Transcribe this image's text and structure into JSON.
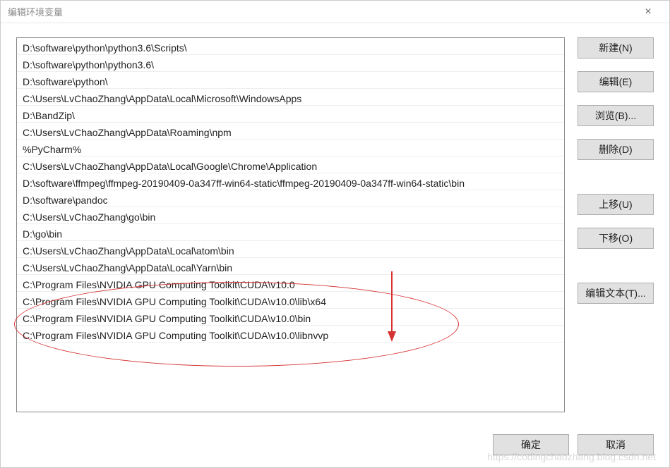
{
  "window": {
    "title": "编辑环境变量",
    "close_symbol": "×"
  },
  "list": {
    "items": [
      "D:\\software\\python\\python3.6\\Scripts\\",
      "D:\\software\\python\\python3.6\\",
      "D:\\software\\python\\",
      "C:\\Users\\LvChaoZhang\\AppData\\Local\\Microsoft\\WindowsApps",
      "D:\\BandZip\\",
      "C:\\Users\\LvChaoZhang\\AppData\\Roaming\\npm",
      "%PyCharm%",
      "C:\\Users\\LvChaoZhang\\AppData\\Local\\Google\\Chrome\\Application",
      "D:\\software\\ffmpeg\\ffmpeg-20190409-0a347ff-win64-static\\ffmpeg-20190409-0a347ff-win64-static\\bin",
      "D:\\software\\pandoc",
      "C:\\Users\\LvChaoZhang\\go\\bin",
      "D:\\go\\bin",
      "C:\\Users\\LvChaoZhang\\AppData\\Local\\atom\\bin",
      "C:\\Users\\LvChaoZhang\\AppData\\Local\\Yarn\\bin",
      "C:\\Program Files\\NVIDIA GPU Computing Toolkit\\CUDA\\v10.0",
      "C:\\Program Files\\NVIDIA GPU Computing Toolkit\\CUDA\\v10.0\\lib\\x64",
      "C:\\Program Files\\NVIDIA GPU Computing Toolkit\\CUDA\\v10.0\\bin",
      "C:\\Program Files\\NVIDIA GPU Computing Toolkit\\CUDA\\v10.0\\libnvvp"
    ]
  },
  "sidebar": {
    "new_label": "新建(N)",
    "edit_label": "编辑(E)",
    "browse_label": "浏览(B)...",
    "delete_label": "删除(D)",
    "moveup_label": "上移(U)",
    "movedown_label": "下移(O)",
    "edittext_label": "编辑文本(T)..."
  },
  "footer": {
    "ok_label": "确定",
    "cancel_label": "取消"
  },
  "watermark": "https://codingchaozhang.blog.csdn.net"
}
